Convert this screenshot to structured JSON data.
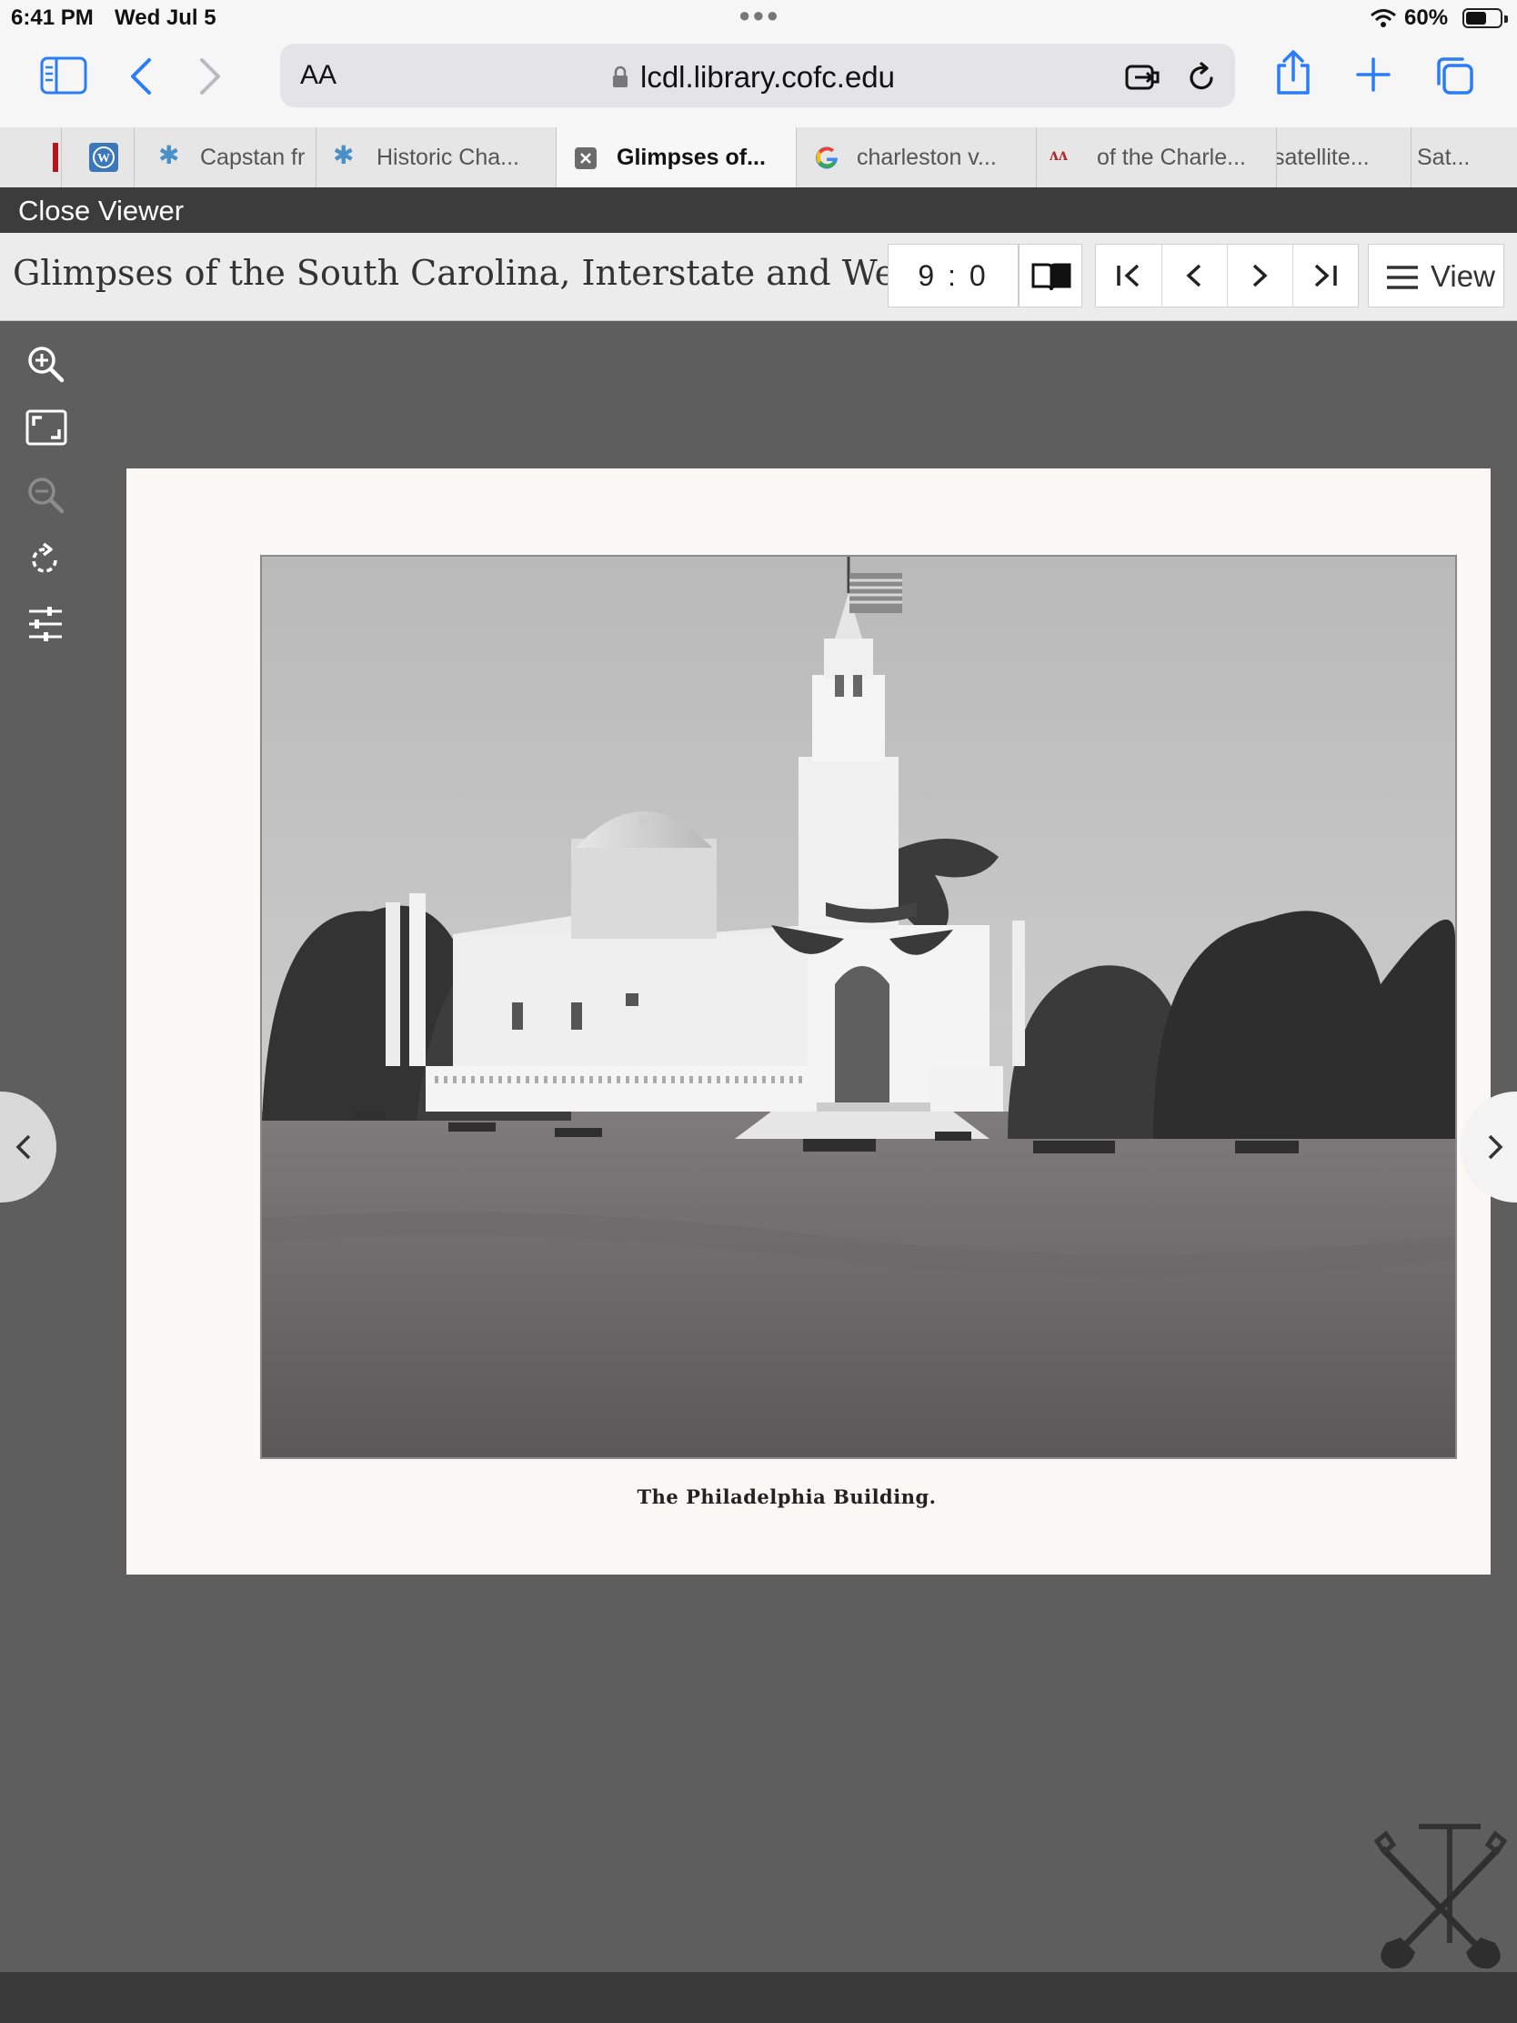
{
  "status_bar": {
    "time": "6:41 PM",
    "date": "Wed Jul 5",
    "battery": "60%",
    "battery_level": 0.6
  },
  "toolbar": {
    "text_size_label": "AA",
    "url": "lcdl.library.cofc.edu"
  },
  "tabs": [
    {
      "label": ""
    },
    {
      "label": ""
    },
    {
      "label": "Capstan fr"
    },
    {
      "label": "Historic Cha..."
    },
    {
      "label": "Glimpses of...",
      "active": true
    },
    {
      "label": "charleston v..."
    },
    {
      "label": "of the Charle..."
    },
    {
      "label": "satellite..."
    },
    {
      "label": "Sat..."
    }
  ],
  "viewer": {
    "close_label": "Close Viewer",
    "title": "Glimpses of the South Carolina, Interstate and Wes...",
    "page_indicator": "9 : 0",
    "view_label": "View"
  },
  "page": {
    "caption": "The Philadelphia Building."
  },
  "colors": {
    "accent": "#2b7cf7",
    "viewer_bg": "#5e5e5e",
    "header_bar": "#3c3c3c"
  }
}
